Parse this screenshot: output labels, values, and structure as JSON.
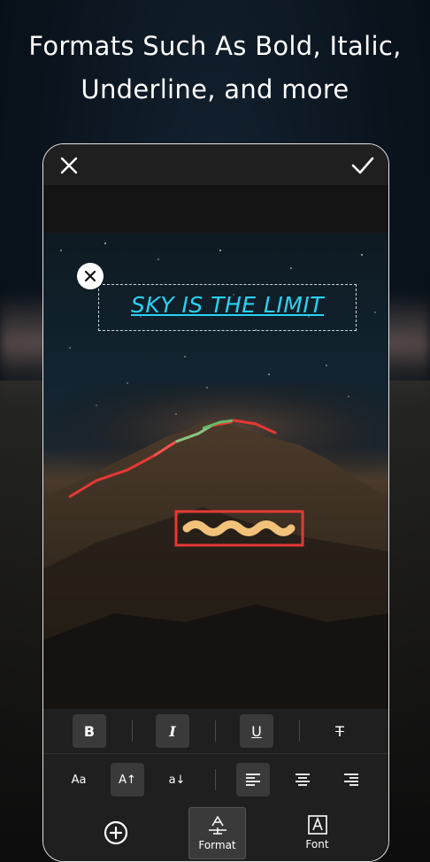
{
  "headline": {
    "line1": "Formats Such As Bold, Italic,",
    "line2": "Underline, and more"
  },
  "editor": {
    "close_icon": "close-icon",
    "confirm_icon": "check-icon"
  },
  "canvas": {
    "text_layer": "SKY IS THE LIMIT",
    "text_color": "#2ad1f2",
    "text_style": [
      "italic",
      "underline"
    ]
  },
  "format_row": {
    "bold": "B",
    "italic": "I",
    "underline": "U",
    "strikethrough": "T",
    "active": [
      "bold",
      "italic",
      "underline"
    ]
  },
  "size_row": {
    "case_label": "Aa",
    "size_up_label": "A↑",
    "size_down_label": "a↓",
    "alignment_selected": "left"
  },
  "bottom_tabs": {
    "add_icon": "plus-circle-icon",
    "format_label": "Format",
    "font_label": "Font",
    "selected": "Format"
  },
  "colors": {
    "accent_text": "#2ad1f2",
    "panel": "#1f1f1f",
    "active_button": "#3a3a3a"
  }
}
